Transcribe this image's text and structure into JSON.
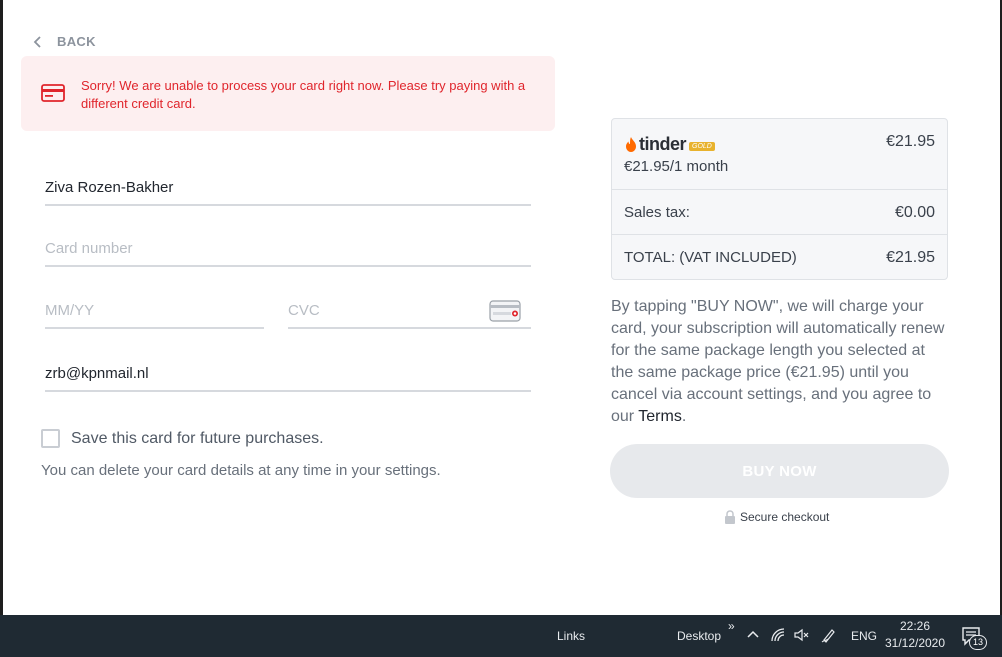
{
  "nav": {
    "back_label": "BACK"
  },
  "alert": {
    "message": "Sorry! We are unable to process your card right now. Please try paying with a different credit card."
  },
  "form": {
    "name_value": "Ziva Rozen-Bakher",
    "card_placeholder": "Card number",
    "expiry_placeholder": "MM/YY",
    "cvc_placeholder": "CVC",
    "email_value": "zrb@kpnmail.nl",
    "save_card_label": "Save this card for future purchases.",
    "save_card_checked": false,
    "hint": "You can delete your card details at any time in your settings."
  },
  "summary": {
    "brand": "tinder",
    "brand_badge": "GOLD",
    "plan": "€21.95/1 month",
    "price": "€21.95",
    "tax_label": "Sales tax:",
    "tax_value": "€0.00",
    "total_label": "TOTAL: (VAT INCLUDED)",
    "total_value": "€21.95"
  },
  "legal": {
    "text": "By tapping \"BUY NOW\", we will charge your card, your subscription will automatically renew for the same package length you selected at the same package price (€21.95) until you cancel via account settings, and you agree to our ",
    "terms_link": "Terms",
    "end": "."
  },
  "buy": {
    "label": "BUY NOW"
  },
  "secure": {
    "label": "Secure checkout"
  },
  "taskbar": {
    "links": "Links",
    "desktop": "Desktop",
    "overflow": "»",
    "lang": "ENG",
    "time": "22:26",
    "date": "31/12/2020",
    "notif_count": "13"
  },
  "colors": {
    "error": "#e0252c",
    "alert_bg": "#fdeff0",
    "button_disabled": "#e7e9ec",
    "brand_orange": "#ff6a00",
    "brand_gold": "#e8b22d"
  }
}
